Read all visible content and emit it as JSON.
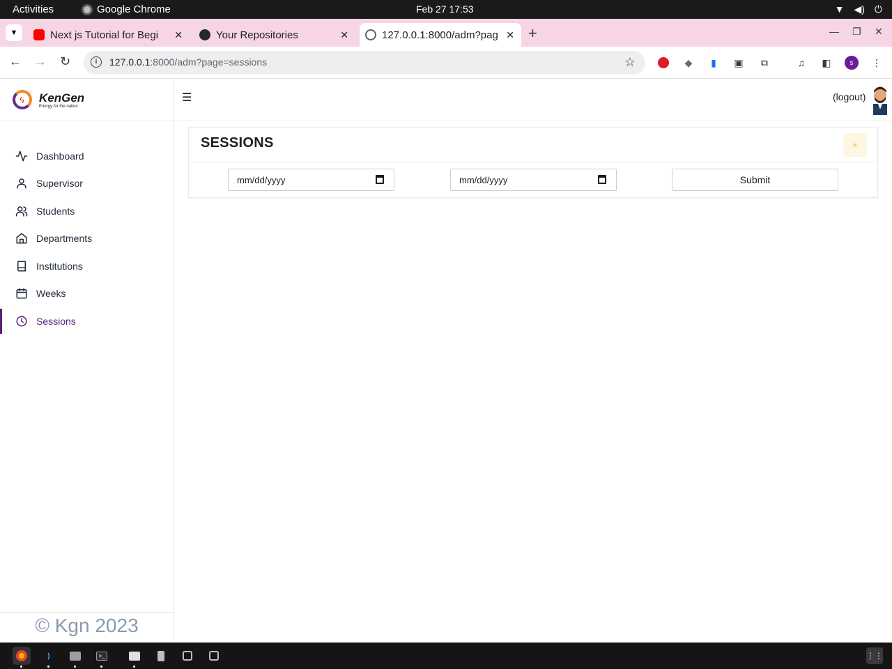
{
  "system": {
    "activities": "Activities",
    "app_name": "Google Chrome",
    "clock": "Feb 27  17:53"
  },
  "browser": {
    "tabs": [
      {
        "title": "Next js Tutorial for Begi",
        "icon": "youtube-icon",
        "active": false
      },
      {
        "title": "Your Repositories",
        "icon": "github-icon",
        "active": false
      },
      {
        "title": "127.0.0.1:8000/adm?pag",
        "icon": "globe-icon",
        "active": true
      }
    ],
    "url_host": "127.0.0.1",
    "url_rest": ":8000/adm?page=sessions",
    "colors": {
      "tabstrip": "#f6d5e4",
      "profile": "#6a1b9a"
    },
    "profile_initial": "s"
  },
  "app": {
    "brand": "KenGen",
    "tagline": "Energy for the nation",
    "nav": [
      {
        "label": "Dashboard",
        "icon": "activity-icon",
        "active": false
      },
      {
        "label": "Supervisor",
        "icon": "user-icon",
        "active": false
      },
      {
        "label": "Students",
        "icon": "users-icon",
        "active": false
      },
      {
        "label": "Departments",
        "icon": "home-icon",
        "active": false
      },
      {
        "label": "Institutions",
        "icon": "book-icon",
        "active": false
      },
      {
        "label": "Weeks",
        "icon": "calendar-icon",
        "active": false
      },
      {
        "label": "Sessions",
        "icon": "clock-icon",
        "active": true
      }
    ],
    "footer": "© Kgn 2023",
    "logout": "(logout)",
    "accent": "#5a1d78"
  },
  "sessions": {
    "title": "SESSIONS",
    "add_label": "+",
    "start_date_placeholder": "mm/dd/yyyy",
    "end_date_placeholder": "mm/dd/yyyy",
    "submit_label": "Submit"
  }
}
